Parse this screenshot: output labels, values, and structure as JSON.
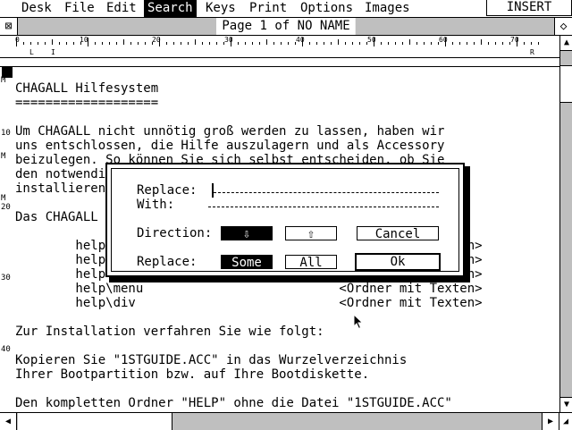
{
  "menubar": {
    "items": [
      "Desk",
      "File",
      "Edit",
      "Search",
      "Keys",
      "Print",
      "Options",
      "Images"
    ],
    "active": "Search",
    "mode": "INSERT"
  },
  "window": {
    "title": "Page 1 of NO NAME",
    "close_icon": "close-icon",
    "full_icon": "fullscreen-icon"
  },
  "ruler": {
    "numbers": [
      "0",
      "10",
      "20",
      "30",
      "40",
      "50",
      "60",
      "70"
    ],
    "left_margin": "L",
    "indent": "I",
    "right_margin": "R"
  },
  "gutter": {
    "labels": [
      "M",
      "10",
      "M",
      "20",
      "30",
      "40",
      "M"
    ]
  },
  "document": {
    "lines": [
      "CHAGALL Hilfesystem",
      "===================",
      "",
      "Um CHAGALL nicht unnötig groß werden zu lassen, haben wir",
      "uns entschlossen, die Hilfe auszulagern und als Accessory",
      "beizulegen. So können Sie sich selbst entscheiden, ob Sie",
      "den notwendigen Speicher opfern wollen oder nicht. Zum",
      "installieren gehen Sie folgendermaßen vor:",
      "",
      "Das CHAGALL Hilfesystem besteht aus folgenden Ordnern:",
      "",
      "        help\\                              <Ordner mit Texten>",
      "        help\\                              <Ordner mit Texten>",
      "        help\\                              <Ordner mit Texten>",
      "        help\\menu                          <Ordner mit Texten>",
      "        help\\div                           <Ordner mit Texten>",
      "",
      "Zur Installation verfahren Sie wie folgt:",
      "",
      "Kopieren Sie \"1STGUIDE.ACC\" in das Wurzelverzeichnis",
      "Ihrer Bootpartition bzw. auf Ihre Bootdiskette.",
      "",
      "Den kompletten Ordner \"HELP\" ohne die Datei \"1STGUIDE.ACC\""
    ]
  },
  "dialog": {
    "replace_label": "Replace:",
    "with_label": "With:",
    "replace_value": "",
    "with_value": "",
    "direction_label": "Direction:",
    "direction_down": "⇩",
    "direction_up": "⇧",
    "cancel_label": "Cancel",
    "replace_mode_label": "Replace:",
    "some_label": "Some",
    "all_label": "All",
    "ok_label": "Ok",
    "direction_selected": "down",
    "replace_selected": "some"
  },
  "scroll": {
    "up_icon": "arrow-up-icon",
    "down_icon": "arrow-down-icon",
    "left_icon": "arrow-left-icon",
    "right_icon": "arrow-right-icon"
  }
}
